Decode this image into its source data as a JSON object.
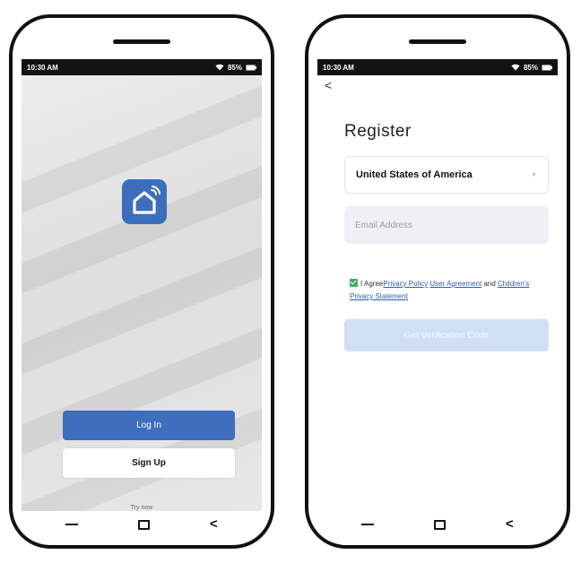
{
  "left_screen": {
    "status": {
      "time": "10:30 AM",
      "battery": "85%"
    },
    "buttons": {
      "login": "Log In",
      "signup": "Sign Up"
    },
    "try_now": "Try now",
    "icons": {
      "logo": "smart-home-icon",
      "wifi": "wifi-icon",
      "battery": "battery-icon"
    }
  },
  "right_screen": {
    "status": {
      "time": "10:30 AM",
      "battery": "85%"
    },
    "back": "<",
    "title": "Register",
    "country": "United States of America",
    "email_placeholder": "Email Address",
    "agreement": {
      "prefix": "I Agree",
      "privacy_policy": "Privacy Policy",
      "user_agreement": "User Agreement",
      "and": "and",
      "children_privacy": "Children's Privacy Statement"
    },
    "verify_button": "Get Verification Code"
  },
  "nav": {
    "recent": "<"
  },
  "colors": {
    "primary": "#3e6ebd",
    "status_bar": "#131313",
    "checkbox": "#3faf5c",
    "link": "#2d5ea8",
    "disabled_button": "#cfe0f5"
  }
}
